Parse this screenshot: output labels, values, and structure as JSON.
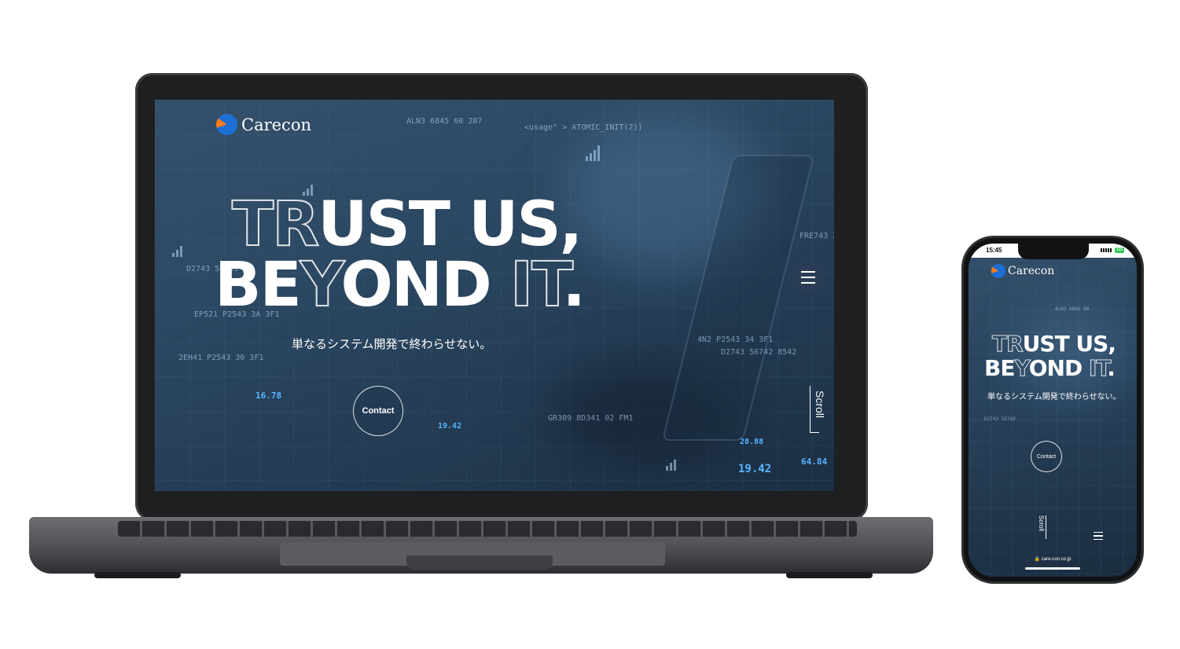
{
  "laptop": {
    "brand": "Carecon",
    "headline": {
      "line1_outline": "TR",
      "line1_solid": "UST US,",
      "line2_solid_a": "BE",
      "line2_outline_a": "Y",
      "line2_solid_b": "OND ",
      "line2_outline_b": "IT",
      "line2_solid_c": "."
    },
    "tagline": "単なるシステム開発で終わらせない。",
    "contact_label": "Contact",
    "scroll_label": "Scroll",
    "ticker_values": [
      "16.78",
      "19.42",
      "64.84",
      "28.88",
      "19.42"
    ]
  },
  "phone": {
    "status_time": "15:45",
    "battery": "100",
    "brand": "Carecon",
    "headline": {
      "line1_outline": "TR",
      "line1_solid": "UST US,",
      "line2_solid_a": "BE",
      "line2_outline_a": "Y",
      "line2_solid_b": "OND ",
      "line2_outline_b": "IT",
      "line2_solid_c": "."
    },
    "tagline": "単なるシステム開発で終わらせない。",
    "contact_label": "Contact",
    "scroll_label": "Scroll",
    "url": "care-con.co.jp"
  },
  "colors": {
    "screen_bg": "#2c4862",
    "ticker_blue": "#5ab4ff",
    "logo_blue": "#1d6fd6",
    "logo_orange": "#ff7a1a"
  },
  "icons": [
    "logo-icon",
    "menu-icon",
    "scroll-arrow-icon",
    "lock-icon"
  ]
}
